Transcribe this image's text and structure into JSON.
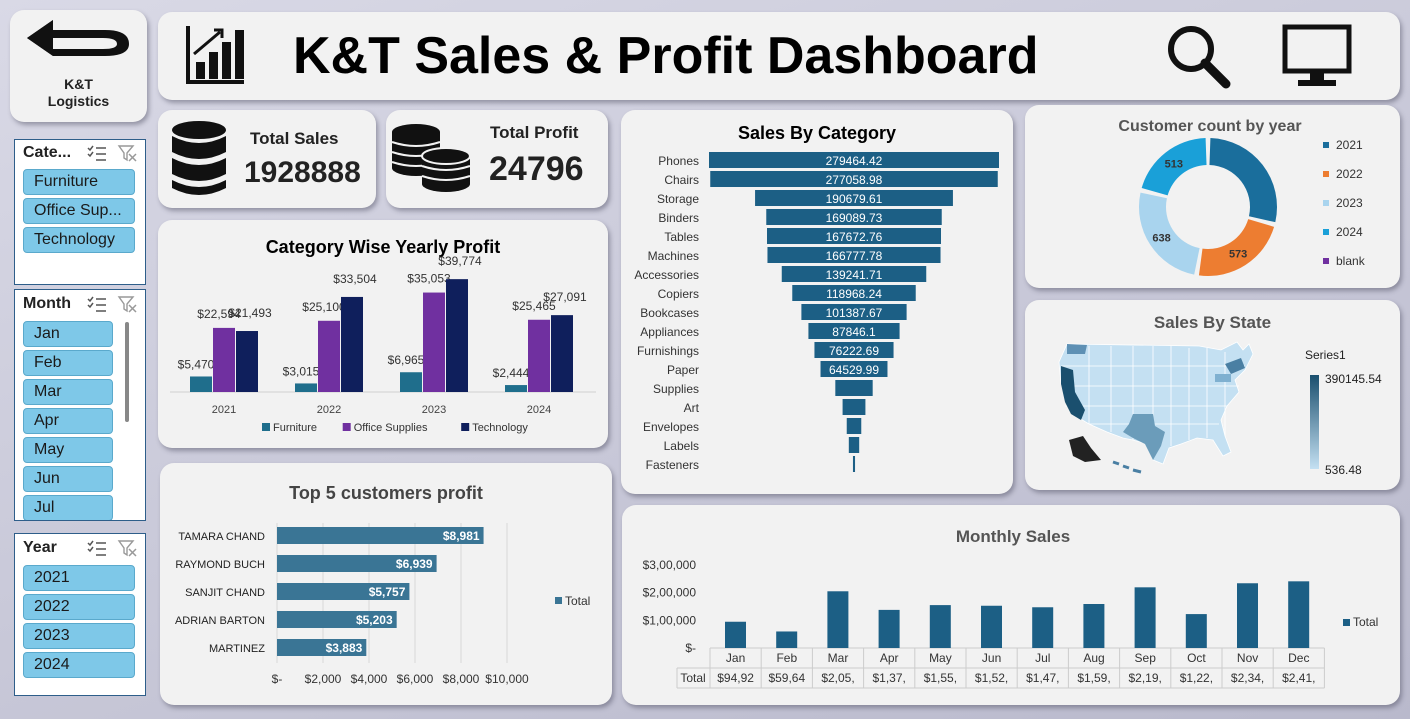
{
  "brand": {
    "name_line1": "K&T",
    "name_line2": "Logistics"
  },
  "header": {
    "title": "K&T Sales & Profit Dashboard"
  },
  "kpis": {
    "total_sales_label": "Total Sales",
    "total_sales_value": "1928888",
    "total_profit_label": "Total Profit",
    "total_profit_value": "24796"
  },
  "slicers": {
    "category": {
      "title": "Cate...",
      "items": [
        "Furniture",
        "Office Sup...",
        "Technology"
      ]
    },
    "month": {
      "title": "Month",
      "items": [
        "Jan",
        "Feb",
        "Mar",
        "Apr",
        "May",
        "Jun",
        "Jul"
      ]
    },
    "year": {
      "title": "Year",
      "items": [
        "2021",
        "2022",
        "2023",
        "2024"
      ]
    }
  },
  "colors": {
    "furniture": "#1f6e8c",
    "office": "#7030a0",
    "technology": "#0f1f5c",
    "bar": "#1c5f85",
    "customer_bar": "#3a7595"
  },
  "chart_data": [
    {
      "id": "category_profit",
      "type": "bar",
      "title": "Category Wise Yearly Profit",
      "categories": [
        "2021",
        "2022",
        "2023",
        "2024"
      ],
      "series": [
        {
          "name": "Furniture",
          "values": [
            5470,
            3015,
            6965,
            2444
          ],
          "labels": [
            "$5,470",
            "$3,015",
            "$6,965",
            "$2,444"
          ]
        },
        {
          "name": "Office Supplies",
          "values": [
            22594,
            25100,
            35053,
            25465
          ],
          "labels": [
            "$22,594",
            "$25,100",
            "$35,053",
            "$25,465"
          ]
        },
        {
          "name": "Technology",
          "values": [
            21493,
            33504,
            39774,
            27091
          ],
          "labels": [
            "$21,493",
            "$33,504",
            "$39,774",
            "$27,091"
          ]
        }
      ],
      "legend": "bottom"
    },
    {
      "id": "sales_by_category",
      "type": "bar",
      "title": "Sales By Category",
      "categories": [
        "Phones",
        "Chairs",
        "Storage",
        "Binders",
        "Tables",
        "Machines",
        "Accessories",
        "Copiers",
        "Bookcases",
        "Appliances",
        "Furnishings",
        "Paper",
        "Supplies",
        "Art",
        "Envelopes",
        "Labels",
        "Fasteners"
      ],
      "values": [
        279464.42,
        277058.98,
        190679.61,
        169089.73,
        167672.76,
        166777.78,
        139241.71,
        118968.24,
        101387.67,
        87846.1,
        76222.69,
        64529.99,
        36000,
        22000,
        14000,
        10000,
        2000
      ],
      "labels": [
        "279464.42",
        "277058.98",
        "190679.61",
        "169089.73",
        "167672.76",
        "166777.78",
        "139241.71",
        "118968.24",
        "101387.67",
        "87846.1",
        "76222.69",
        "64529.99",
        "",
        "",
        "",
        "",
        ""
      ]
    },
    {
      "id": "customer_count",
      "type": "pie",
      "title": "Customer count by year",
      "legend_items": [
        {
          "name": "2021",
          "color": "#1a6e9c"
        },
        {
          "name": "2022",
          "color": "#ed7d31"
        },
        {
          "name": "2023",
          "color": "#a9d4ee"
        },
        {
          "name": "2024",
          "color": "#1aa0d8"
        },
        {
          "name": "blank",
          "color": "#7030a0"
        }
      ],
      "slices": [
        {
          "name": "2021",
          "value": 707,
          "label": "",
          "color": "#1a6e9c"
        },
        {
          "name": "2022",
          "value": 573,
          "label": "573",
          "color": "#ed7d31"
        },
        {
          "name": "2023",
          "value": 638,
          "label": "638",
          "color": "#a9d4ee"
        },
        {
          "name": "2024",
          "value": 513,
          "label": "513",
          "color": "#1aa0d8"
        }
      ]
    },
    {
      "id": "sales_by_state",
      "type": "heatmap",
      "title": "Sales By State",
      "legend_title": "Series1",
      "max_label": "390145.54",
      "min_label": "536.48"
    },
    {
      "id": "top_customers",
      "type": "bar",
      "title": "Top 5 customers profit",
      "categories": [
        "TAMARA CHAND",
        "RAYMOND BUCH",
        "SANJIT CHAND",
        "ADRIAN BARTON",
        "MARTINEZ"
      ],
      "values": [
        8981,
        6939,
        5757,
        5203,
        3883
      ],
      "labels": [
        "$8,981",
        "$6,939",
        "$5,757",
        "$5,203",
        "$3,883"
      ],
      "series_name": "Total",
      "xticks": [
        "$-",
        "$2,000",
        "$4,000",
        "$6,000",
        "$8,000",
        "$10,000"
      ],
      "xlim": [
        0,
        10000
      ]
    },
    {
      "id": "monthly_sales",
      "type": "bar",
      "title": "Monthly Sales",
      "categories": [
        "Jan",
        "Feb",
        "Mar",
        "Apr",
        "May",
        "Jun",
        "Jul",
        "Aug",
        "Sep",
        "Oct",
        "Nov",
        "Dec"
      ],
      "values": [
        94924,
        59751,
        205005,
        137762,
        155029,
        152718,
        147238,
        159044,
        219341,
        122583,
        234000,
        241000
      ],
      "table_labels": [
        "$94,92",
        "$59,64",
        "$2,05,",
        "$1,37,",
        "$1,55,",
        "$1,52,",
        "$1,47,",
        "$1,59,",
        "$2,19,",
        "$1,22,",
        "$2,34,",
        "$2,41,"
      ],
      "series_name": "Total",
      "yticks": [
        "$-",
        "$1,00,000",
        "$2,00,000",
        "$3,00,000"
      ],
      "ylim": [
        0,
        300000
      ]
    }
  ]
}
